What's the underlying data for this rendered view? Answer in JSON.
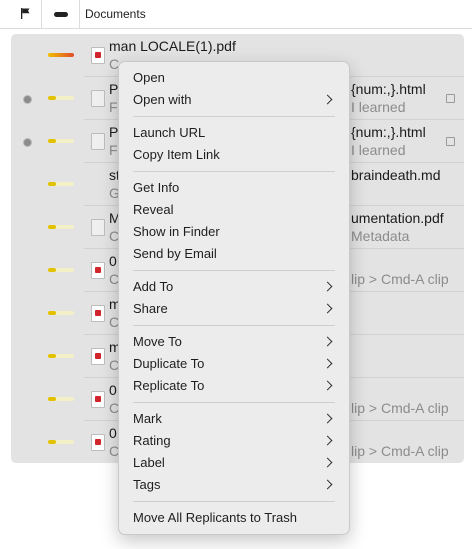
{
  "header": {
    "column_title": "Documents"
  },
  "rows": [
    {
      "title": "man LOCALE(1).pdf",
      "subtitle": "C",
      "right_title": "",
      "right_sub": ""
    },
    {
      "title": "P",
      "subtitle": "F",
      "right_title": "{num:,}.html",
      "right_sub": "I learned"
    },
    {
      "title": "P",
      "subtitle": "F",
      "right_title": "{num:,}.html",
      "right_sub": "I learned"
    },
    {
      "title": "st",
      "subtitle": "G",
      "right_title": "braindeath.md",
      "right_sub": ""
    },
    {
      "title": "M",
      "subtitle": "C",
      "right_title": "umentation.pdf",
      "right_sub": "Metadata"
    },
    {
      "title": "0",
      "subtitle": "C",
      "right_title": "",
      "right_sub": "lip > Cmd-A clip"
    },
    {
      "title": "m",
      "subtitle": "C",
      "right_title": "",
      "right_sub": ""
    },
    {
      "title": "m",
      "subtitle": "C",
      "right_title": "",
      "right_sub": ""
    },
    {
      "title": "0",
      "subtitle": "C",
      "right_title": "",
      "right_sub": "lip > Cmd-A clip"
    },
    {
      "title": "0",
      "subtitle": "C",
      "right_title": "",
      "right_sub": "lip > Cmd-A clip"
    }
  ],
  "menu": {
    "open": "Open",
    "open_with": "Open with",
    "launch_url": "Launch URL",
    "copy_item_link": "Copy Item Link",
    "get_info": "Get Info",
    "reveal": "Reveal",
    "show_in_finder": "Show in Finder",
    "send_by_email": "Send by Email",
    "add_to": "Add To",
    "share": "Share",
    "move_to": "Move To",
    "duplicate_to": "Duplicate To",
    "replicate_to": "Replicate To",
    "mark": "Mark",
    "rating": "Rating",
    "label": "Label",
    "tags": "Tags",
    "move_all_replicants": "Move All Replicants to Trash"
  }
}
